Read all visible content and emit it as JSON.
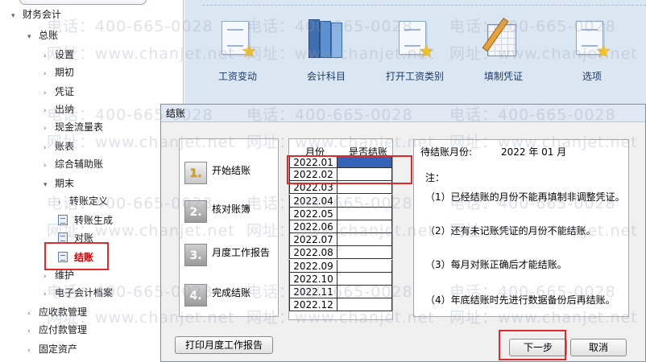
{
  "nav": {
    "items": [
      {
        "label": "财务会计",
        "arrow": "▾"
      },
      {
        "label": "总账",
        "arrow": "▾"
      },
      {
        "label": "设置",
        "arrow": "›"
      },
      {
        "label": "期初",
        "arrow": "›"
      },
      {
        "label": "凭证",
        "arrow": "›"
      },
      {
        "label": "出纳",
        "arrow": "›"
      },
      {
        "label": "现金流量表",
        "arrow": "›"
      },
      {
        "label": "账表",
        "arrow": "›"
      },
      {
        "label": "综合辅助账",
        "arrow": "›"
      },
      {
        "label": "期末",
        "arrow": "▾"
      },
      {
        "label": "转账定义",
        "arrow": "›"
      },
      {
        "label": "转账生成"
      },
      {
        "label": "对账"
      },
      {
        "label": "结账"
      },
      {
        "label": "维护",
        "arrow": "›"
      },
      {
        "label": "电子会计档案",
        "arrow": "›"
      },
      {
        "label": "应收款管理",
        "arrow": "›"
      },
      {
        "label": "应付款管理",
        "arrow": "›"
      },
      {
        "label": "固定资产",
        "arrow": "›"
      }
    ]
  },
  "quickbar": [
    {
      "label": "工资变动",
      "icon": "page-star-icon"
    },
    {
      "label": "会计科目",
      "icon": "books-icon"
    },
    {
      "label": "打开工资类别",
      "icon": "page-star-icon"
    },
    {
      "label": "填制凭证",
      "icon": "pen-notebook-icon"
    },
    {
      "label": "选项",
      "icon": "page-star-icon"
    }
  ],
  "dialog": {
    "title": "结账",
    "steps": [
      {
        "num": "1.",
        "label": "开始结账"
      },
      {
        "num": "2.",
        "label": "核对账簿"
      },
      {
        "num": "3.",
        "label": "月度工作报告"
      },
      {
        "num": "4.",
        "label": "完成结账"
      }
    ],
    "table": {
      "col_month": "月份",
      "col_closed": "是否结账",
      "months": [
        "2022.01",
        "2022.02",
        "2022.03",
        "2022.04",
        "2022.05",
        "2022.06",
        "2022.07",
        "2022.08",
        "2022.09",
        "2022.10",
        "2022.11",
        "2022.12"
      ],
      "selected_month": "2022.01"
    },
    "notes": {
      "pending_label": "待结账月份:",
      "pending_value": "2022 年 01 月",
      "note_title": "注：",
      "items": [
        "（1）已经结账的月份不能再填制非调整凭证。",
        "（2）还有未记账凭证的月份不能结账。",
        "（3）每月对账正确后才能结账。",
        "（4）年底结账时先进行数据备份后再结账。"
      ]
    },
    "buttons": {
      "print": "打印月度工作报告",
      "next": "下一步",
      "cancel": "取消"
    }
  },
  "watermark": {
    "phone": "电话：400-665-0028",
    "site": "网址：www.chanjet.net"
  },
  "colors": {
    "highlight": "#e32a2a",
    "selected_cell": "#3463b8",
    "main_bg": "#dbe6f3"
  }
}
